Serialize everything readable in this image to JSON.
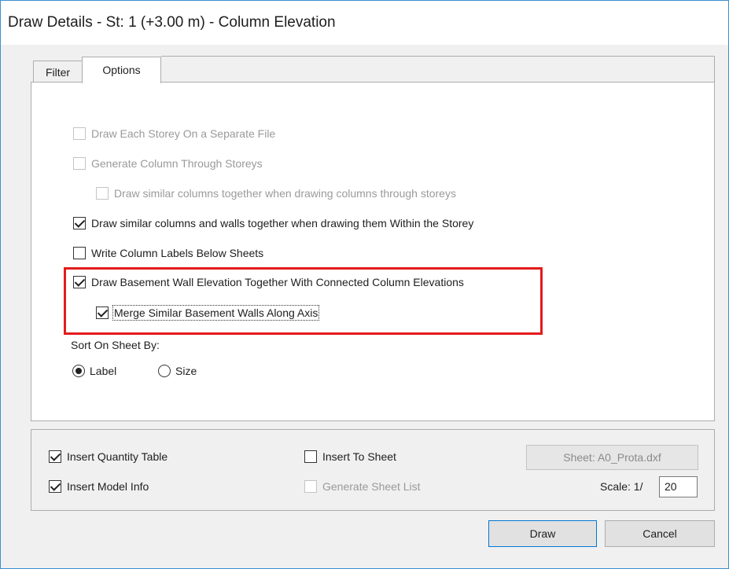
{
  "window": {
    "title": "Draw Details - St: 1 (+3.00 m) - Column Elevation"
  },
  "tabs": [
    {
      "label": "Filter",
      "active": false
    },
    {
      "label": "Options",
      "active": true
    }
  ],
  "options": {
    "separate_file": {
      "label": "Draw Each Storey On a Separate File",
      "checked": false,
      "enabled": false
    },
    "through_storeys": {
      "label": "Generate Column Through Storeys",
      "checked": false,
      "enabled": false
    },
    "similar_through": {
      "label": "Draw similar columns together when drawing columns through storeys",
      "checked": false,
      "enabled": false
    },
    "similar_within": {
      "label": "Draw similar columns and walls together when drawing them Within the Storey",
      "checked": true,
      "enabled": true
    },
    "labels_below": {
      "label": "Write Column Labels Below Sheets",
      "checked": false,
      "enabled": true
    },
    "basement_wall": {
      "label": "Draw Basement Wall Elevation Together With Connected Column Elevations",
      "checked": true,
      "enabled": true
    },
    "merge_walls": {
      "label": "Merge Similar Basement Walls Along Axis",
      "checked": true,
      "enabled": true
    }
  },
  "sort": {
    "label": "Sort On Sheet By:",
    "options": [
      {
        "label": "Label",
        "selected": true
      },
      {
        "label": "Size",
        "selected": false
      }
    ]
  },
  "bottom": {
    "quantity_table": {
      "label": "Insert Quantity Table",
      "checked": true,
      "enabled": true
    },
    "model_info": {
      "label": "Insert Model Info",
      "checked": true,
      "enabled": true
    },
    "insert_sheet": {
      "label": "Insert To Sheet",
      "checked": false,
      "enabled": true
    },
    "sheet_list": {
      "label": "Generate Sheet List",
      "checked": false,
      "enabled": false
    },
    "sheet_button": "Sheet: A0_Prota.dxf",
    "scale_label": "Scale: 1/",
    "scale_value": "20"
  },
  "buttons": {
    "draw": "Draw",
    "cancel": "Cancel"
  },
  "colors": {
    "highlight": "#e31b1b",
    "window_border": "#3c8fd0"
  }
}
